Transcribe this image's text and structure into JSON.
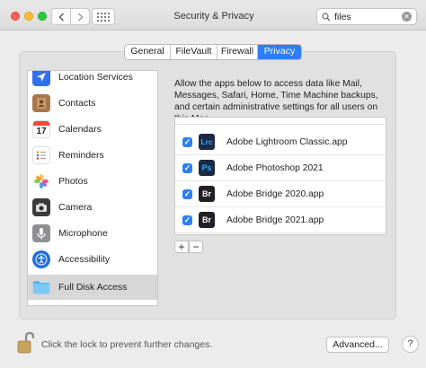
{
  "window": {
    "title": "Security & Privacy"
  },
  "toolbar": {
    "search_value": "files",
    "search_placeholder": "Search"
  },
  "tabs": [
    {
      "label": "General",
      "active": false
    },
    {
      "label": "FileVault",
      "active": false
    },
    {
      "label": "Firewall",
      "active": false
    },
    {
      "label": "Privacy",
      "active": true
    }
  ],
  "sidebar": {
    "items": [
      {
        "label": "Location Services",
        "icon": "location-arrow-icon"
      },
      {
        "label": "Contacts",
        "icon": "contacts-book-icon"
      },
      {
        "label": "Calendars",
        "icon": "calendar-icon"
      },
      {
        "label": "Reminders",
        "icon": "reminders-list-icon"
      },
      {
        "label": "Photos",
        "icon": "photos-flower-icon"
      },
      {
        "label": "Camera",
        "icon": "camera-icon"
      },
      {
        "label": "Microphone",
        "icon": "microphone-icon"
      },
      {
        "label": "Accessibility",
        "icon": "accessibility-icon"
      },
      {
        "label": "Full Disk Access",
        "icon": "folder-icon",
        "selected": true
      }
    ],
    "calendar_day": "17"
  },
  "main": {
    "description": "Allow the apps below to access data like Mail, Messages, Safari, Home, Time Machine backups, and certain administrative settings for all users on this Mac.",
    "apps": [
      {
        "name": "Adobe Lightroom Classic.app",
        "icon_label": "Lrc",
        "checked": true
      },
      {
        "name": "Adobe Photoshop 2021",
        "icon_label": "Ps",
        "checked": true
      },
      {
        "name": "Adobe Bridge 2020.app",
        "icon_label": "Br",
        "checked": true
      },
      {
        "name": "Adobe Bridge 2021.app",
        "icon_label": "Br",
        "checked": true
      }
    ],
    "add_label": "+",
    "remove_label": "−"
  },
  "footer": {
    "lock_text": "Click the lock to prevent further changes.",
    "advanced_label": "Advanced...",
    "help_label": "?"
  },
  "colors": {
    "accent": "#2c7ef5",
    "selected_row": "#d7d7d7",
    "adobe_dark": "#1d2a45"
  }
}
